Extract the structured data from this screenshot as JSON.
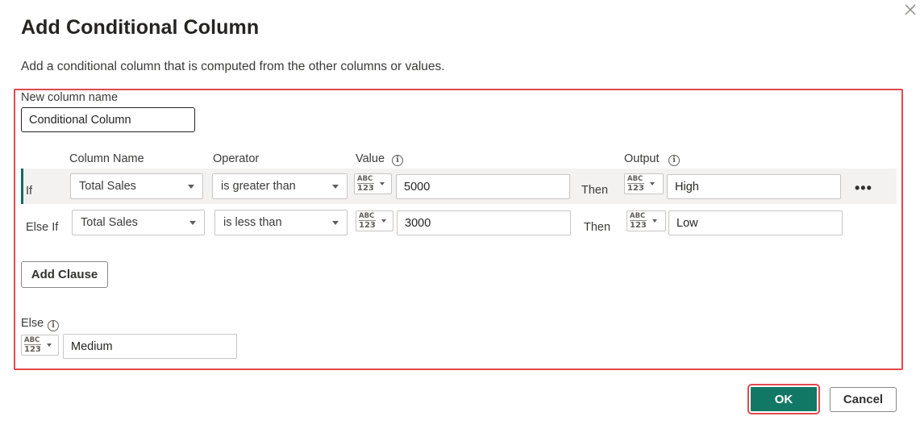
{
  "dialog": {
    "title": "Add Conditional Column",
    "description": "Add a conditional column that is computed from the other columns or values."
  },
  "new_column": {
    "label": "New column name",
    "value": "Conditional Column"
  },
  "headers": {
    "column_name": "Column Name",
    "operator": "Operator",
    "value": "Value",
    "output": "Output"
  },
  "type_icon": {
    "line1": "ABC",
    "line2": "123"
  },
  "clauses": [
    {
      "keyword": "If",
      "column": "Total Sales",
      "operator": "is greater than",
      "value": "5000",
      "then": "Then",
      "output": "High"
    },
    {
      "keyword": "Else If",
      "column": "Total Sales",
      "operator": "is less than",
      "value": "3000",
      "then": "Then",
      "output": "Low"
    }
  ],
  "add_clause_label": "Add Clause",
  "else": {
    "label": "Else",
    "value": "Medium"
  },
  "buttons": {
    "ok": "OK",
    "cancel": "Cancel"
  },
  "icons": {
    "close": "close-icon",
    "info": "info-icon",
    "more": "more-options-icon",
    "type": "data-type-icon"
  },
  "colors": {
    "accent": "#117865",
    "highlight": "#e2484e",
    "selected_row": "#f3f2f1"
  }
}
